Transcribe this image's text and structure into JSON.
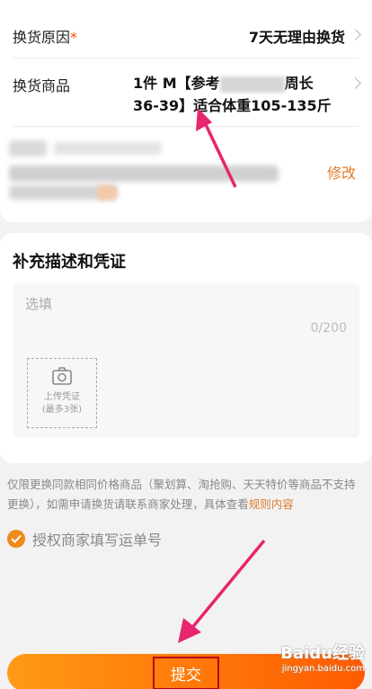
{
  "exchange_form": {
    "reason": {
      "label": "换货原因",
      "required_mark": "*",
      "value": "7天无理由换货"
    },
    "product": {
      "label": "换货商品",
      "value_line1": "1件 M【参考",
      "value_line1_tail": "周长",
      "value_line2": "36-39】适合体重105-135斤"
    },
    "address": {
      "modify_label": "修改"
    }
  },
  "evidence": {
    "title": "补充描述和凭证",
    "placeholder": "选填",
    "counter": "0/200",
    "upload_line1": "上传凭证",
    "upload_line2": "(最多3张)"
  },
  "notice": {
    "text": "仅限更换同款相同价格商品（聚划算、淘抢购、天天特价等商品不支持更换），如需申请换货请联系商家处理，具体查看",
    "link": "规则内容"
  },
  "authorize": {
    "label": "授权商家填写运单号",
    "checked": true
  },
  "submit": {
    "label": "提交"
  },
  "watermark": {
    "main": "Baidu经验",
    "sub": "jingyan.baidu.com"
  },
  "colors": {
    "accent": "#ff5000",
    "link": "#e07b2a",
    "annotation_arrow": "#e8256f"
  }
}
